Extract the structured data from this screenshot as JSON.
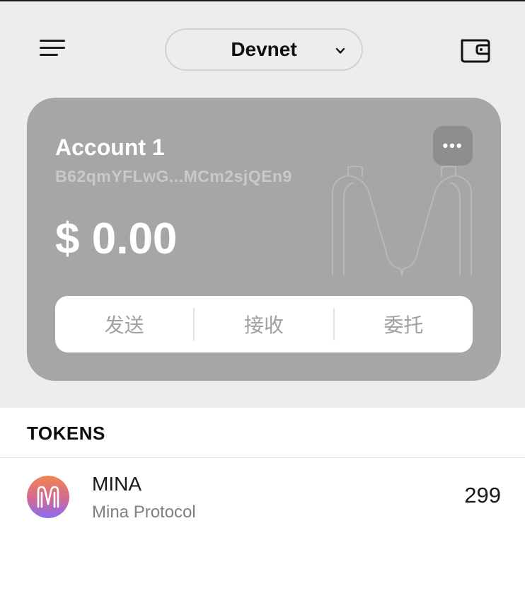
{
  "header": {
    "network": "Devnet"
  },
  "account": {
    "name": "Account 1",
    "address": "B62qmYFLwG...MCm2sjQEn9",
    "balance": "$ 0.00",
    "actions": [
      "发送",
      "接收",
      "委托"
    ]
  },
  "tokens": {
    "title": "TOKENS",
    "items": [
      {
        "symbol": "MINA",
        "name": "Mina Protocol",
        "amount": "299"
      }
    ]
  },
  "colors": {
    "background": "#ededf0",
    "card": "#a6a6a8",
    "token_logo_top": "#f08650",
    "token_logo_bottom": "#8a6af2"
  },
  "icons": [
    "menu-icon",
    "chevron-down-icon",
    "wallet-icon",
    "more-icon",
    "mina-logo-icon"
  ]
}
